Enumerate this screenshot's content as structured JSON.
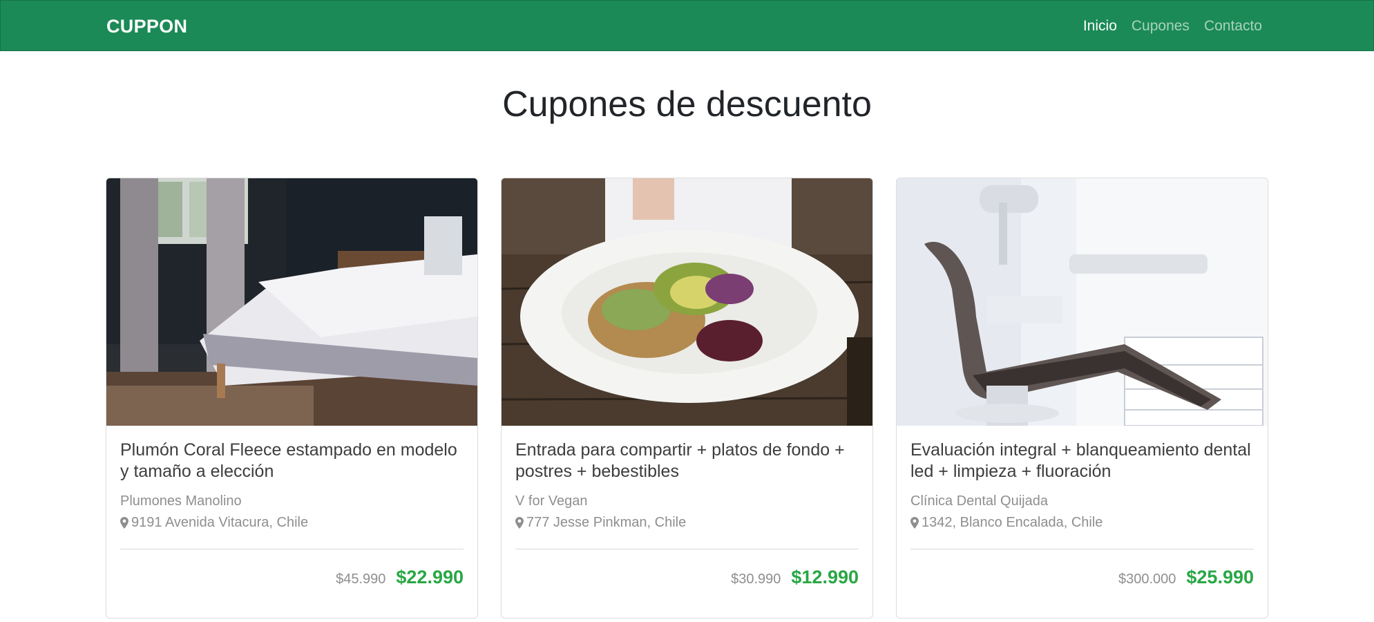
{
  "navbar": {
    "brand": "CUPPON",
    "links": [
      {
        "label": "Inicio",
        "active": true
      },
      {
        "label": "Cupones",
        "active": false
      },
      {
        "label": "Contacto",
        "active": false
      }
    ],
    "background_color": "#1b8a56"
  },
  "page": {
    "title": "Cupones de descuento"
  },
  "cards": [
    {
      "image_subject": "bed-photo",
      "title": "Plumón Coral Fleece estampado en modelo y tamaño a elección",
      "merchant": "Plumones Manolino",
      "address": "9191 Avenida Vitacura, Chile",
      "old_price": "$45.990",
      "new_price": "$22.990"
    },
    {
      "image_subject": "salad-plate-photo",
      "title": "Entrada para compartir + platos de fondo + postres + bebestibles",
      "merchant": "V for Vegan",
      "address": "777 Jesse Pinkman, Chile",
      "old_price": "$30.990",
      "new_price": "$12.990"
    },
    {
      "image_subject": "dental-chair-photo",
      "title": "Evaluación integral + blanqueamiento dental led + limpieza + fluoración",
      "merchant": "Clínica Dental Quijada",
      "address": "1342, Blanco Encalada, Chile",
      "old_price": "$300.000",
      "new_price": "$25.990"
    }
  ],
  "colors": {
    "accent_green": "#28a745",
    "muted_text": "#8e8e8e"
  }
}
